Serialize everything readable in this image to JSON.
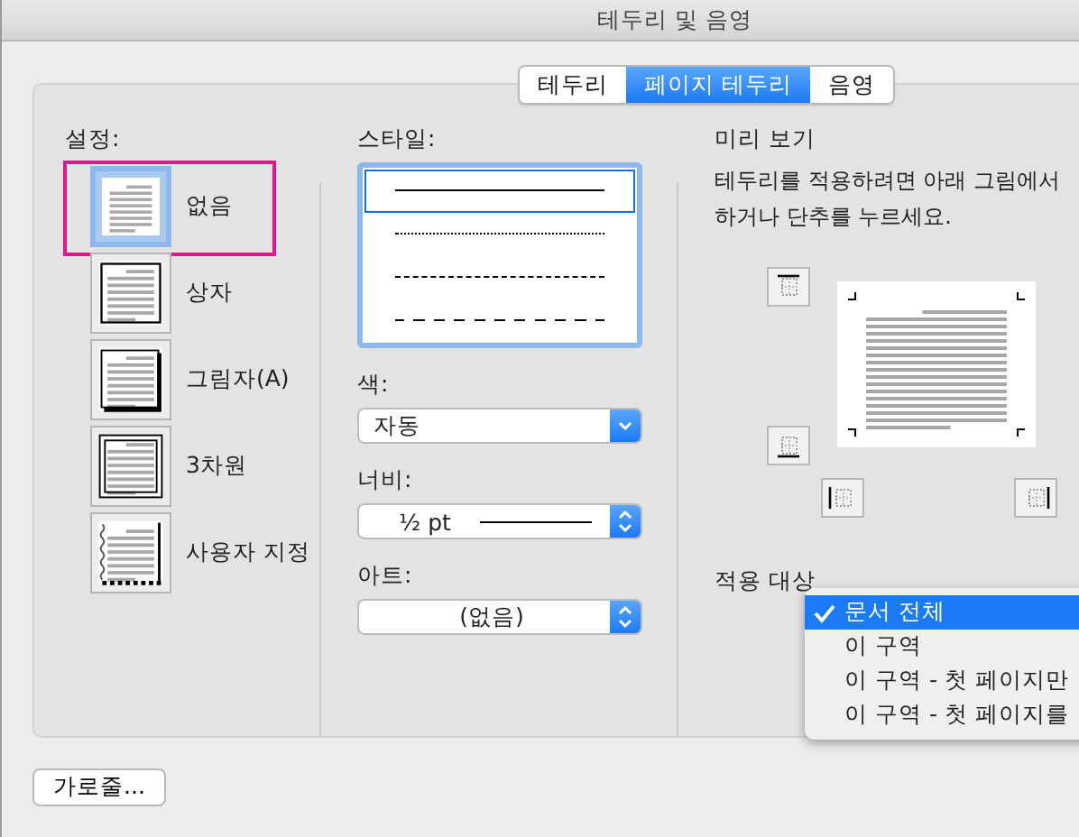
{
  "window": {
    "title": "테두리 및 음영"
  },
  "tabs": [
    {
      "label": "테두리",
      "selected": false
    },
    {
      "label": "페이지 테두리",
      "selected": true
    },
    {
      "label": "음영",
      "selected": false
    }
  ],
  "settings": {
    "label": "설정:",
    "items": [
      {
        "kind": "none",
        "label": "없음",
        "selected": true,
        "highlighted": true
      },
      {
        "kind": "box",
        "label": "상자",
        "selected": false,
        "highlighted": false
      },
      {
        "kind": "shadow",
        "label": "그림자(A)",
        "selected": false,
        "highlighted": false
      },
      {
        "kind": "threed",
        "label": "3차원",
        "selected": false,
        "highlighted": false
      },
      {
        "kind": "custom",
        "label": "사용자 지정",
        "selected": false,
        "highlighted": false
      }
    ]
  },
  "style": {
    "label": "스타일:",
    "lines": [
      {
        "kind": "solid",
        "selected": true
      },
      {
        "kind": "dotted",
        "selected": false
      },
      {
        "kind": "dashed",
        "selected": false
      },
      {
        "kind": "dashed-wide",
        "selected": false
      }
    ]
  },
  "color": {
    "label": "색:",
    "value": "자동"
  },
  "width": {
    "label": "너비:",
    "value": "½ pt"
  },
  "art": {
    "label": "아트:",
    "value": "(없음)"
  },
  "preview": {
    "label": "미리 보기",
    "description_lines": [
      "테두리를 적용하려면 아래 그림에서",
      "하거나 단추를 누르세요."
    ]
  },
  "apply_to": {
    "label": "적용 대상",
    "options": [
      {
        "label": "문서 전체",
        "selected": true
      },
      {
        "label": "이 구역",
        "selected": false
      },
      {
        "label": "이 구역 - 첫 페이지만",
        "selected": false
      },
      {
        "label": "이 구역 - 첫 페이지를",
        "selected": false
      }
    ]
  },
  "buttons": [
    {
      "label": "가로줄..."
    }
  ]
}
